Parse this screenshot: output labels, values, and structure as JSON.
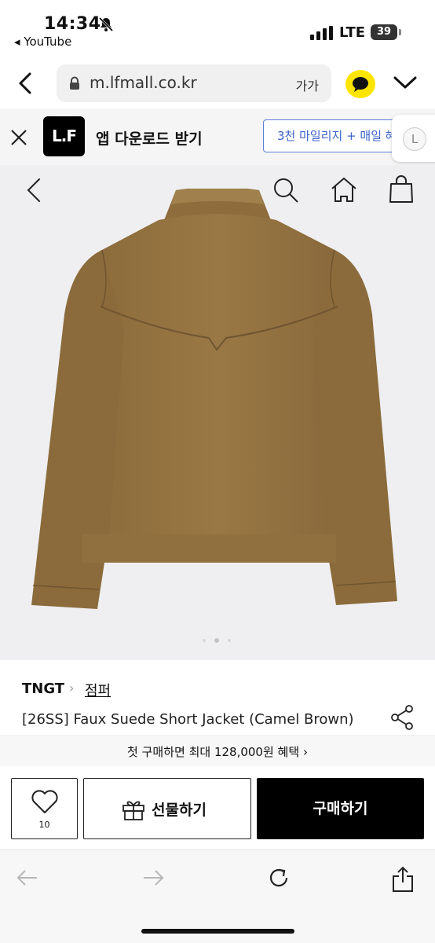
{
  "status_bar": {
    "time": "14:34",
    "back_app": "YouTube",
    "network": "LTE",
    "battery": "39"
  },
  "browser": {
    "url": "m.lfmall.co.kr",
    "text_size_label": "가가"
  },
  "app_banner": {
    "logo_text": "L.F",
    "title": "앱 다운로드 받기",
    "promo": "3천 마일리지 + 매일 혜",
    "side_tab_letter": "L"
  },
  "gallery": {
    "total": 3,
    "active_index": 1
  },
  "product": {
    "brand": "TNGT",
    "category": "점퍼",
    "name": "[26SS] Faux Suede Short Jacket (Camel Brown)"
  },
  "coupon": {
    "text": "첫 구매하면 최대 128,000원 혜택"
  },
  "actions": {
    "wish_count": "10",
    "gift_label": "선물하기",
    "buy_label": "구매하기"
  },
  "colors": {
    "jacket": "#957340",
    "photo_bg": "#efeff1",
    "kakao": "#fee500",
    "promo_blue": "#3c63c9"
  }
}
